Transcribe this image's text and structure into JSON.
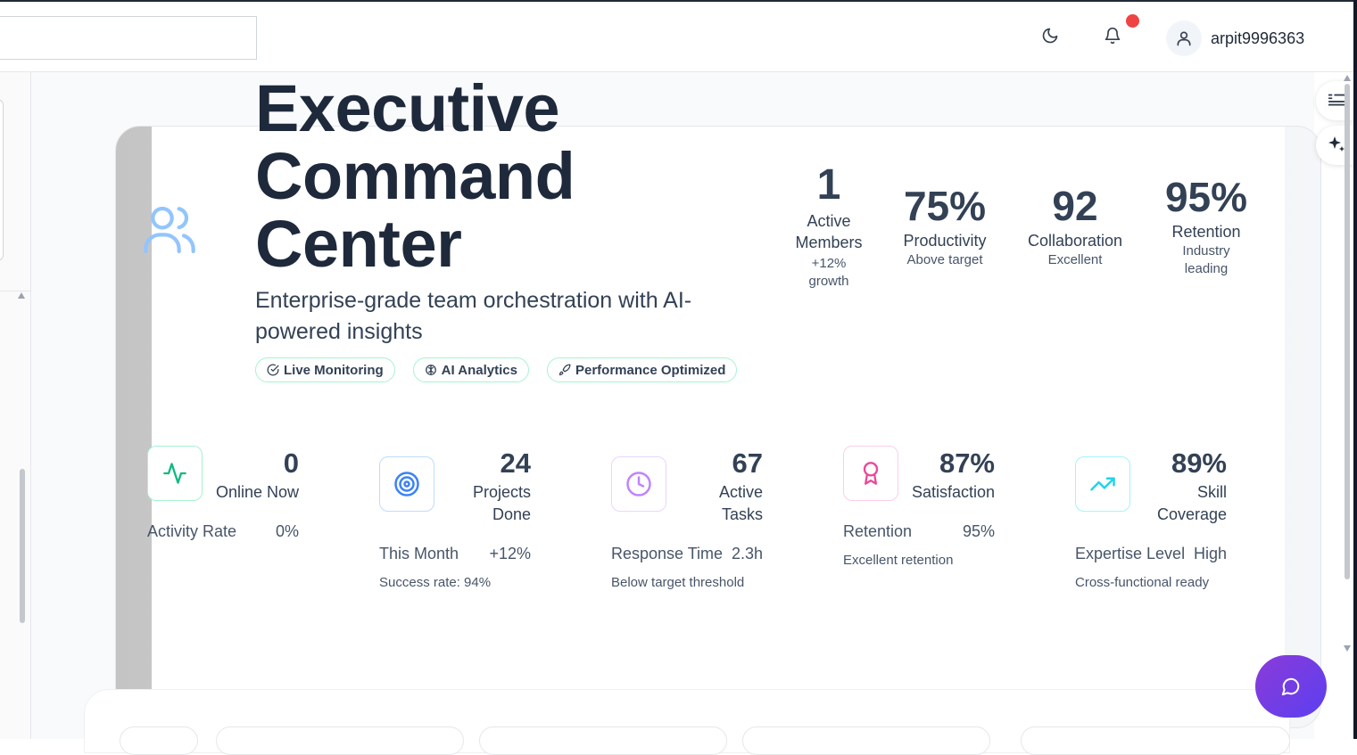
{
  "header": {
    "search": {
      "value": "",
      "placeholder": ""
    },
    "user": {
      "name": "arpit9996363"
    }
  },
  "hero": {
    "title": "Executive Command Center",
    "subtitle": "Enterprise-grade team orchestration with AI-powered insights",
    "chips": [
      "Live Monitoring",
      "AI Analytics",
      "Performance Optimized"
    ],
    "stats": [
      {
        "value": "1",
        "label": "Active Members",
        "sub": "+12% growth"
      },
      {
        "value": "75%",
        "label": "Productivity",
        "sub": "Above target"
      },
      {
        "value": "92",
        "label": "Collaboration",
        "sub": "Excellent"
      },
      {
        "value": "95%",
        "label": "Retention",
        "sub": "Industry leading"
      }
    ]
  },
  "kpis": [
    {
      "icon": "activity-icon",
      "value": "0",
      "label": "Online Now",
      "row_label": "Activity Rate",
      "row_value": "0%",
      "note": ""
    },
    {
      "icon": "target-icon",
      "value": "24",
      "label": "Projects Done",
      "row_label": "This Month",
      "row_value": "+12%",
      "note": "Success rate: 94%"
    },
    {
      "icon": "clock-icon",
      "value": "67",
      "label": "Active Tasks",
      "row_label": "Response Time",
      "row_value": "2.3h",
      "note": "Below target threshold"
    },
    {
      "icon": "award-icon",
      "value": "87%",
      "label": "Satisfaction",
      "row_label": "Retention",
      "row_value": "95%",
      "note": "Excellent retention"
    },
    {
      "icon": "trending-up-icon",
      "value": "89%",
      "label": "Skill Coverage",
      "row_label": "Expertise Level",
      "row_value": "High",
      "note": "Cross-functional ready"
    }
  ],
  "colors": {
    "title": "#1e293b",
    "accent_blue": "#93c5fd",
    "notification": "#ef4444",
    "chip_border": "#a7f3d0",
    "activity": "#10b981",
    "target": "#3b82f6",
    "clock": "#c084fc",
    "award": "#ec4899",
    "trend": "#22d3ee",
    "chat_fab": "#6d3ce6"
  }
}
